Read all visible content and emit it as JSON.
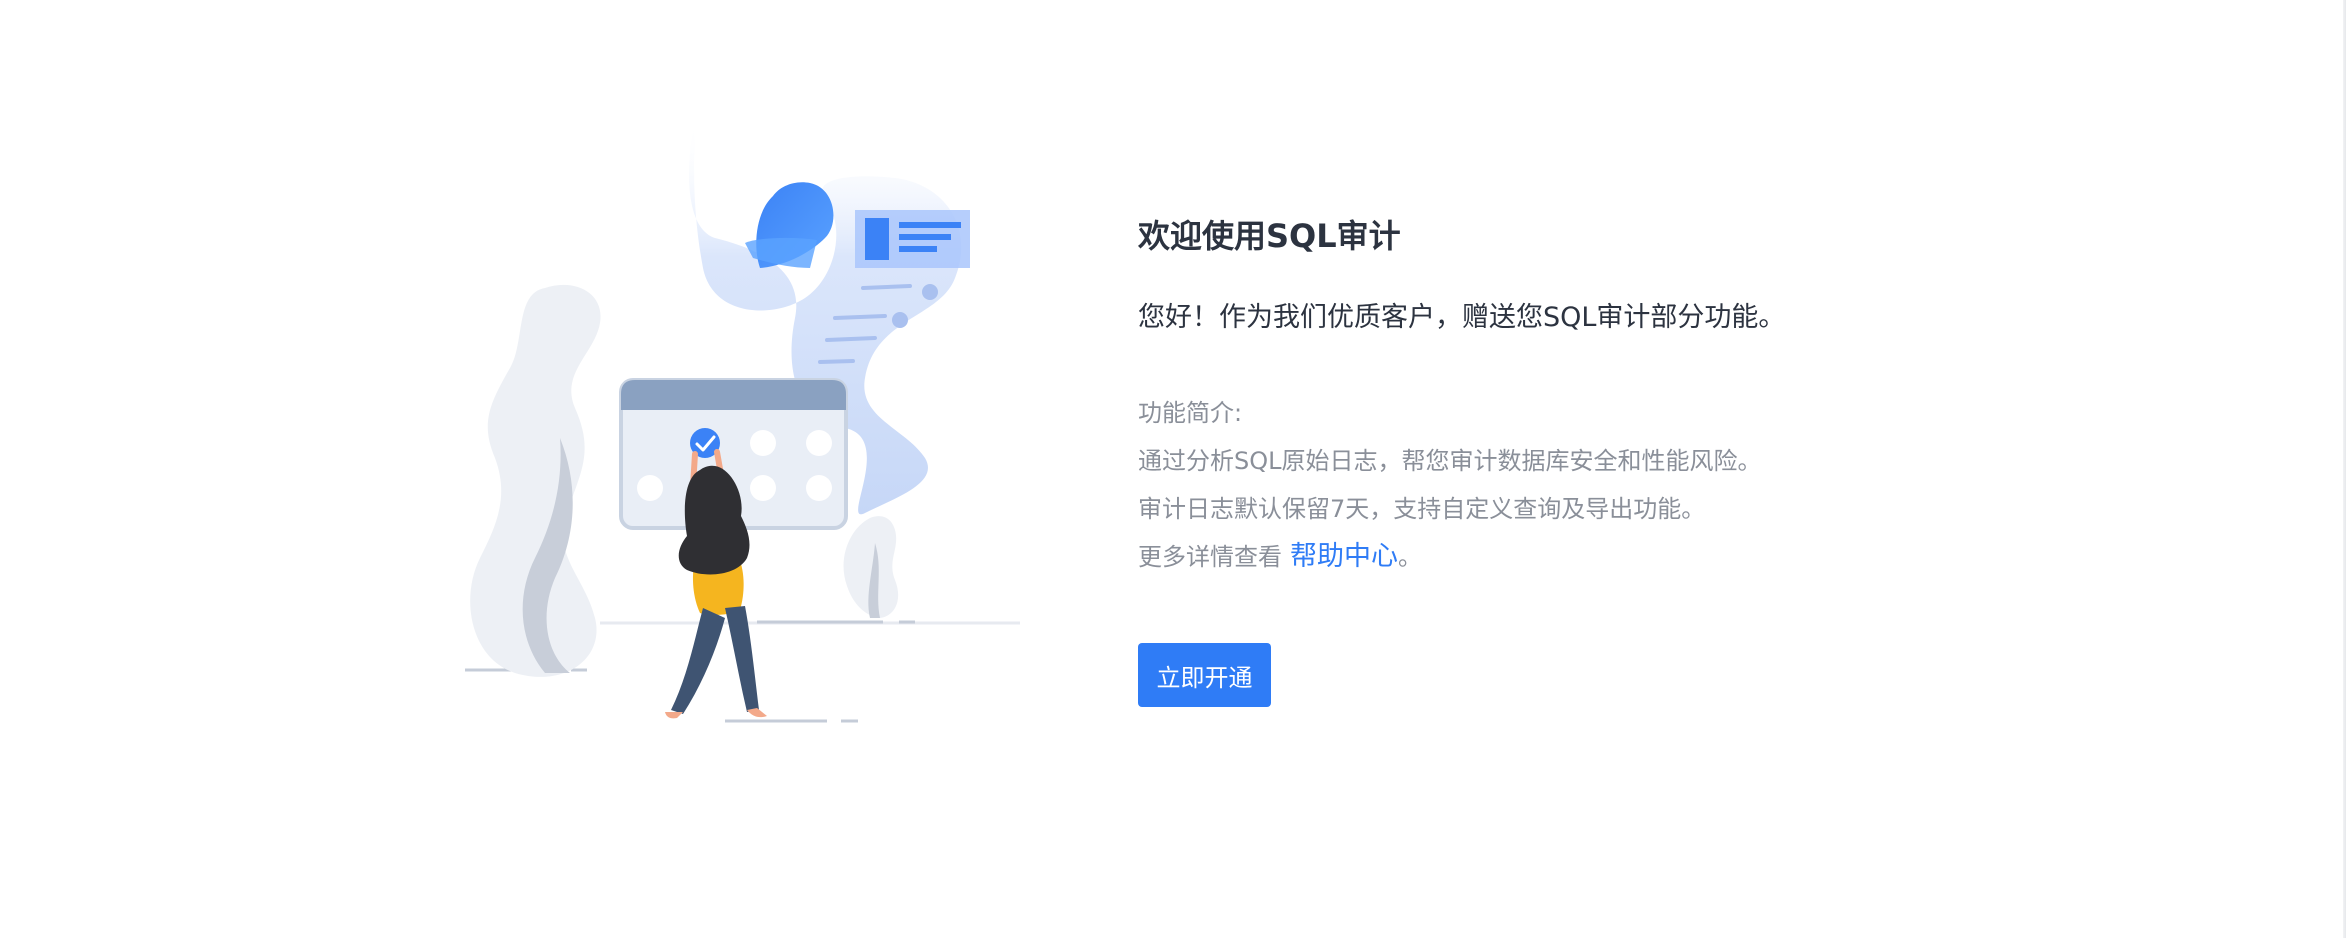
{
  "main": {
    "title": "欢迎使用SQL审计",
    "greeting": "您好！作为我们优质客户，赠送您SQL审计部分功能。",
    "intro_heading": "功能简介:",
    "intro_lines": [
      "通过分析SQL原始日志，帮您审计数据库安全和性能风险。",
      "审计日志默认保留7天，支持自定义查询及导出功能。"
    ],
    "more_prefix": "更多详情查看",
    "help_link": "帮助中心",
    "more_suffix": "。",
    "cta_button": "立即开通"
  },
  "illustration": {
    "icons": [
      "plant-icon",
      "calendar-icon",
      "checkmark-icon",
      "person-icon",
      "document-scroll-icon"
    ]
  },
  "colors": {
    "accent": "#2f7cf6",
    "title_text": "#2c3340",
    "secondary_text": "#8a8f99"
  }
}
